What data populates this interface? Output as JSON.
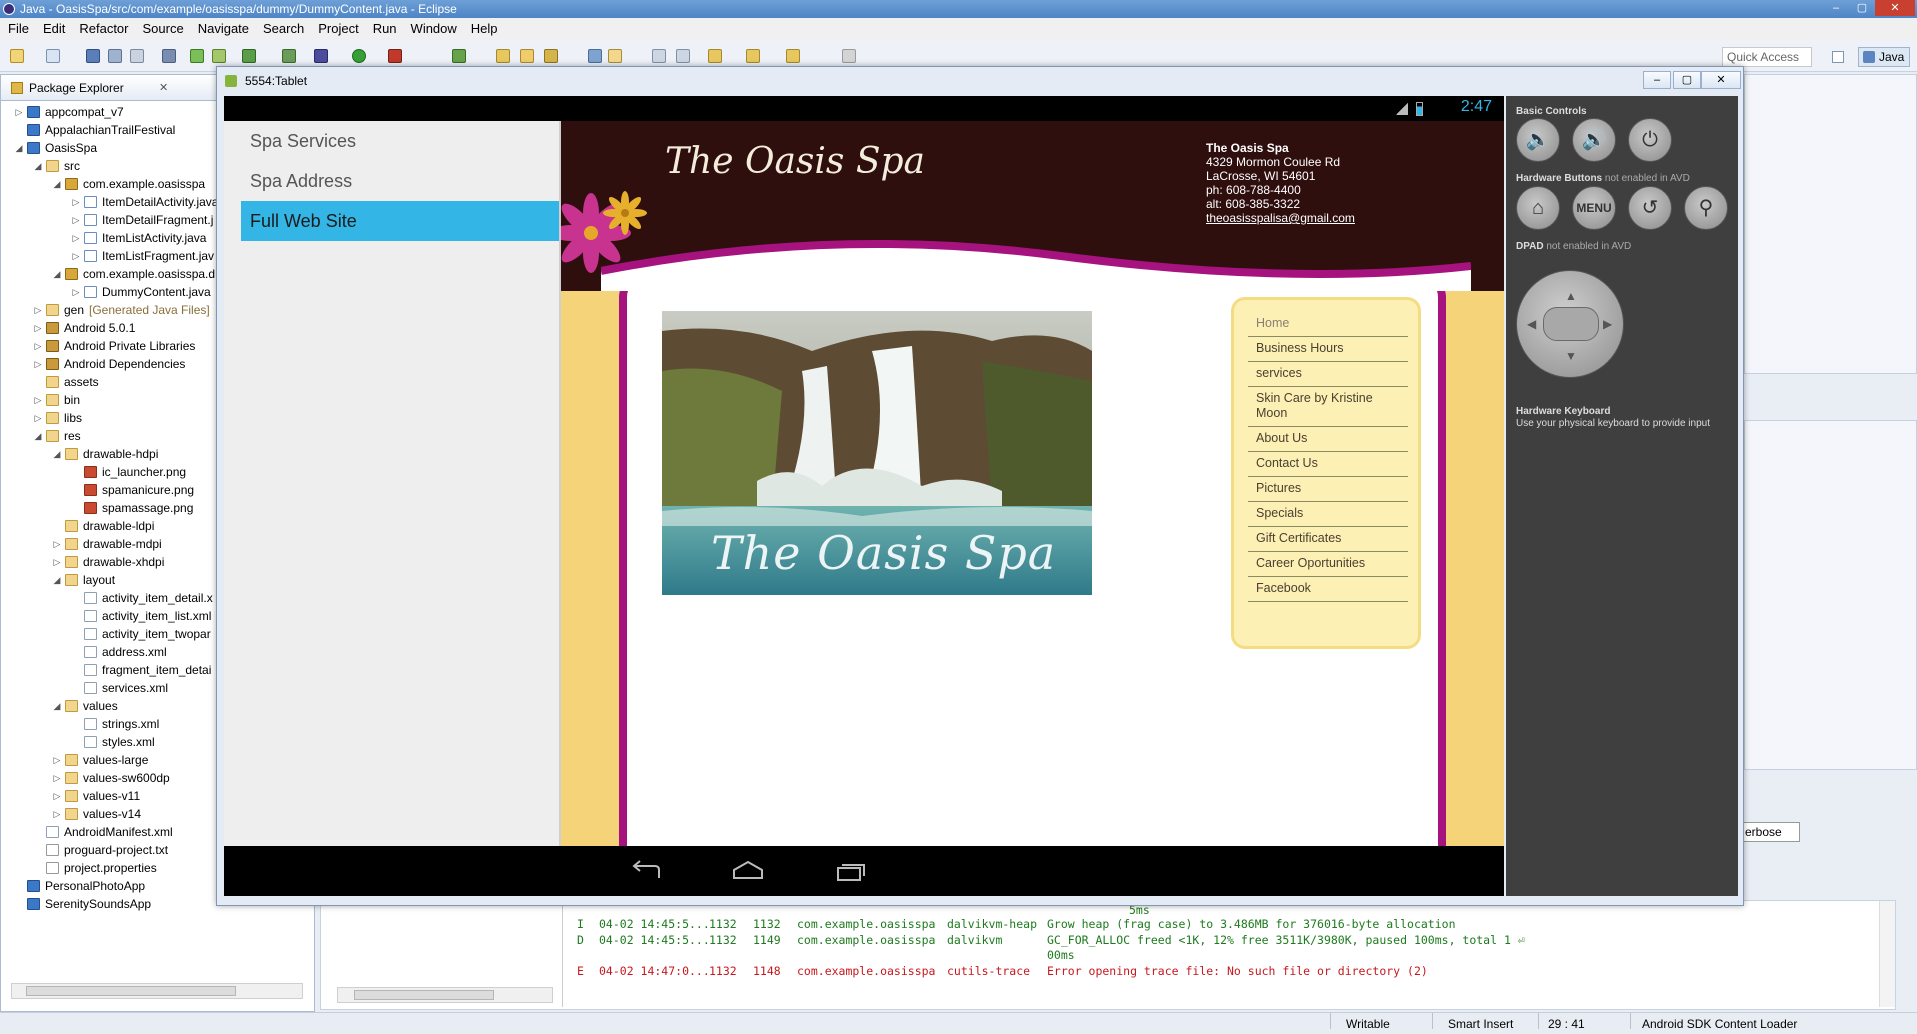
{
  "window": {
    "title": "Java - OasisSpa/src/com/example/oasisspa/dummy/DummyContent.java - Eclipse",
    "min": "–",
    "max": "▢",
    "close": "✕"
  },
  "menu": [
    "File",
    "Edit",
    "Refactor",
    "Source",
    "Navigate",
    "Search",
    "Project",
    "Run",
    "Window",
    "Help"
  ],
  "toolbar": {
    "quick_access": "Quick Access",
    "perspective": "Java"
  },
  "package_explorer": {
    "title": "Package Explorer",
    "close": "✕",
    "items": [
      {
        "label": "appcompat_v7",
        "icon": "project-icon"
      },
      {
        "label": "AppalachianTrailFestival",
        "icon": "project-icon"
      },
      {
        "label": "OasisSpa",
        "icon": "project-icon"
      },
      {
        "label": "src",
        "icon": "folder-icon"
      },
      {
        "label": "com.example.oasisspa",
        "icon": "package-icon"
      },
      {
        "label": "ItemDetailActivity.java",
        "icon": "java-file-icon"
      },
      {
        "label": "ItemDetailFragment.j",
        "icon": "java-file-icon"
      },
      {
        "label": "ItemListActivity.java",
        "icon": "java-file-icon"
      },
      {
        "label": "ItemListFragment.jav",
        "icon": "java-file-icon"
      },
      {
        "label": "com.example.oasisspa.d",
        "icon": "package-icon"
      },
      {
        "label": "DummyContent.java",
        "icon": "java-file-icon"
      },
      {
        "label": "gen",
        "extra": "[Generated Java Files]",
        "icon": "folder-icon"
      },
      {
        "label": "Android 5.0.1",
        "icon": "library-icon"
      },
      {
        "label": "Android Private Libraries",
        "icon": "library-icon"
      },
      {
        "label": "Android Dependencies",
        "icon": "library-icon"
      },
      {
        "label": "assets",
        "icon": "folder-icon"
      },
      {
        "label": "bin",
        "icon": "folder-icon"
      },
      {
        "label": "libs",
        "icon": "folder-icon"
      },
      {
        "label": "res",
        "icon": "folder-icon"
      },
      {
        "label": "drawable-hdpi",
        "icon": "folder-icon"
      },
      {
        "label": "ic_launcher.png",
        "icon": "png-file-icon"
      },
      {
        "label": "spamanicure.png",
        "icon": "png-file-icon"
      },
      {
        "label": "spamassage.png",
        "icon": "png-file-icon"
      },
      {
        "label": "drawable-ldpi",
        "icon": "folder-icon"
      },
      {
        "label": "drawable-mdpi",
        "icon": "folder-icon"
      },
      {
        "label": "drawable-xhdpi",
        "icon": "folder-icon"
      },
      {
        "label": "layout",
        "icon": "folder-icon"
      },
      {
        "label": "activity_item_detail.x",
        "icon": "xml-file-icon"
      },
      {
        "label": "activity_item_list.xml",
        "icon": "xml-file-icon"
      },
      {
        "label": "activity_item_twopar",
        "icon": "xml-file-icon"
      },
      {
        "label": "address.xml",
        "icon": "xml-file-icon"
      },
      {
        "label": "fragment_item_detai",
        "icon": "xml-file-icon"
      },
      {
        "label": "services.xml",
        "icon": "xml-file-icon"
      },
      {
        "label": "values",
        "icon": "folder-icon"
      },
      {
        "label": "strings.xml",
        "icon": "xml-file-icon"
      },
      {
        "label": "styles.xml",
        "icon": "xml-file-icon"
      },
      {
        "label": "values-large",
        "icon": "folder-icon"
      },
      {
        "label": "values-sw600dp",
        "icon": "folder-icon"
      },
      {
        "label": "values-v11",
        "icon": "folder-icon"
      },
      {
        "label": "values-v14",
        "icon": "folder-icon"
      },
      {
        "label": "AndroidManifest.xml",
        "icon": "xml-file-icon"
      },
      {
        "label": "proguard-project.txt",
        "icon": "text-file-icon"
      },
      {
        "label": "project.properties",
        "icon": "text-file-icon"
      },
      {
        "label": "PersonalPhotoApp",
        "icon": "project-icon"
      },
      {
        "label": "SerenitySoundsApp",
        "icon": "project-icon"
      }
    ]
  },
  "emulator": {
    "title": "5554:Tablet",
    "clock": "2:47",
    "sidebar": [
      "Spa Services",
      "Spa Address",
      "Full Web Site"
    ],
    "active_item": "Full Web Site",
    "web": {
      "title": "The Oasis Spa",
      "contact_name": "The Oasis Spa",
      "address1": "4329 Mormon Coulee Rd",
      "address2": "LaCrosse, WI 54601",
      "phone": "ph: 608-788-4400",
      "alt_phone": "alt: 608-385-3322",
      "email": "theoasisspalisa@gmail.com",
      "photo_caption": "The Oasis Spa",
      "nav": [
        "Home",
        "Business Hours",
        "services",
        "Skin Care by Kristine Moon",
        "About Us",
        "Contact Us",
        "Pictures",
        "Specials",
        "Gift Certificates",
        "Career Oportunities",
        "Facebook"
      ]
    },
    "controls": {
      "basic": "Basic Controls",
      "hw_buttons": "Hardware Buttons",
      "hw_note": "not enabled in AVD",
      "menu": "MENU",
      "dpad": "DPAD",
      "dpad_note": "not enabled in AVD",
      "keyboard": "Hardware Keyboard",
      "keyboard_note": "Use your physical keyboard to provide input"
    }
  },
  "logcat": {
    "verbose": "erbose",
    "pre": "5ms",
    "rows": [
      {
        "level": "I",
        "time": "04-02 14:45:5...",
        "pid": "1132",
        "tid": "1132",
        "app": "com.example.oasisspa",
        "tag": "dalvikvm-heap",
        "text": "Grow heap (frag case) to 3.486MB for 376016-byte allocation"
      },
      {
        "level": "D",
        "time": "04-02 14:45:5...",
        "pid": "1132",
        "tid": "1149",
        "app": "com.example.oasisspa",
        "tag": "dalvikvm",
        "text": "GC_FOR_ALLOC freed <1K, 12% free 3511K/3980K, paused 100ms, total 1 ⏎"
      },
      {
        "level": "",
        "time": "",
        "pid": "",
        "tid": "",
        "app": "",
        "tag": "",
        "text": "00ms"
      },
      {
        "level": "E",
        "time": "04-02 14:47:0...",
        "pid": "1132",
        "tid": "1148",
        "app": "com.example.oasisspa",
        "tag": "cutils-trace",
        "text": "Error opening trace file: No such file or directory (2)"
      }
    ]
  },
  "status": {
    "writable": "Writable",
    "insert": "Smart Insert",
    "position": "29 : 41",
    "loader": "Android SDK Content Loader"
  }
}
